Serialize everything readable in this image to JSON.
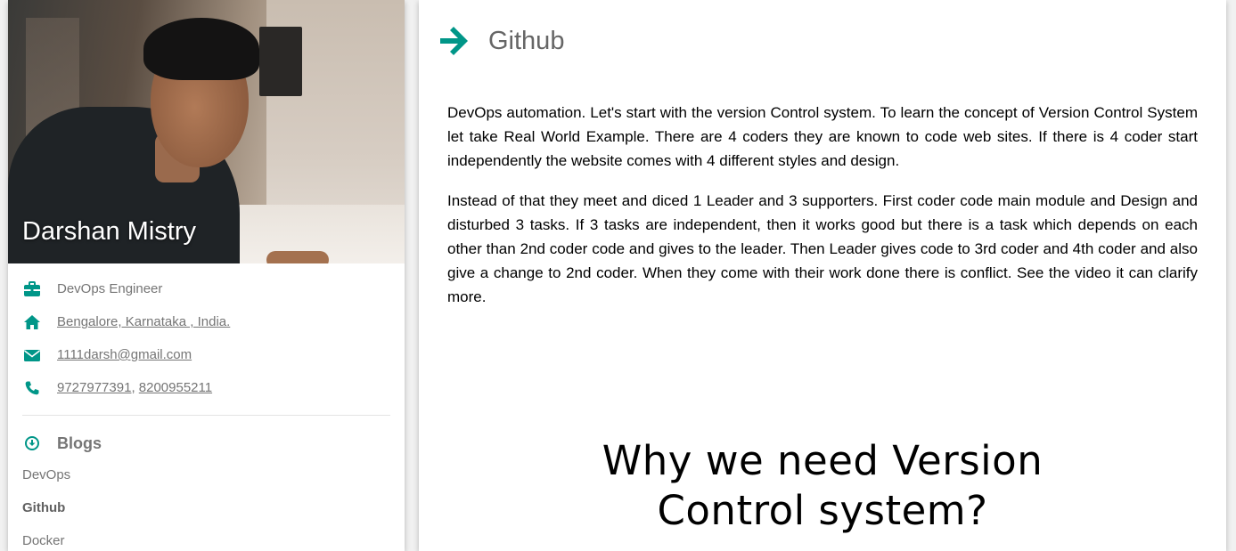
{
  "profile": {
    "name": "Darshan Mistry",
    "job": "DevOps Engineer",
    "location": "Bengalore, Karnataka , India.",
    "email": "1111darsh@gmail.com",
    "phone1": "9727977391",
    "phone_separator": ",",
    "phone2": "8200955211"
  },
  "blogs": {
    "heading": "Blogs",
    "items": [
      {
        "label": "DevOps",
        "active": false
      },
      {
        "label": "Github",
        "active": true
      },
      {
        "label": "Docker",
        "active": false
      }
    ]
  },
  "main": {
    "title": "Github",
    "paragraphs": [
      "DevOps automation. Let's start with the version Control system. To learn the concept of Version Control System let take Real World Example. There are 4 coders they are known to code web sites. If there is 4 coder start independently the website comes with 4 different styles and design.",
      "Instead of that they meet and diced 1 Leader and 3 supporters. First coder code main module and Design and disturbed 3 tasks. If 3 tasks are independent, then it works good but there is a task which depends on each other than 2nd coder code and gives to the leader. Then Leader gives code to 3rd coder and 4th coder and also give a change to 2nd coder. When they come with their work done there is conflict. See the video it can clarify more."
    ],
    "video_title_line1": "Why we need Version",
    "video_title_line2": "Control system?"
  },
  "colors": {
    "accent": "#009688",
    "text_muted": "#757575"
  },
  "icons": {
    "job": "briefcase-icon",
    "location": "home-icon",
    "email": "envelope-icon",
    "phone": "phone-icon",
    "blogs": "arrow-circle-down-icon",
    "title": "arrow-right-icon"
  }
}
